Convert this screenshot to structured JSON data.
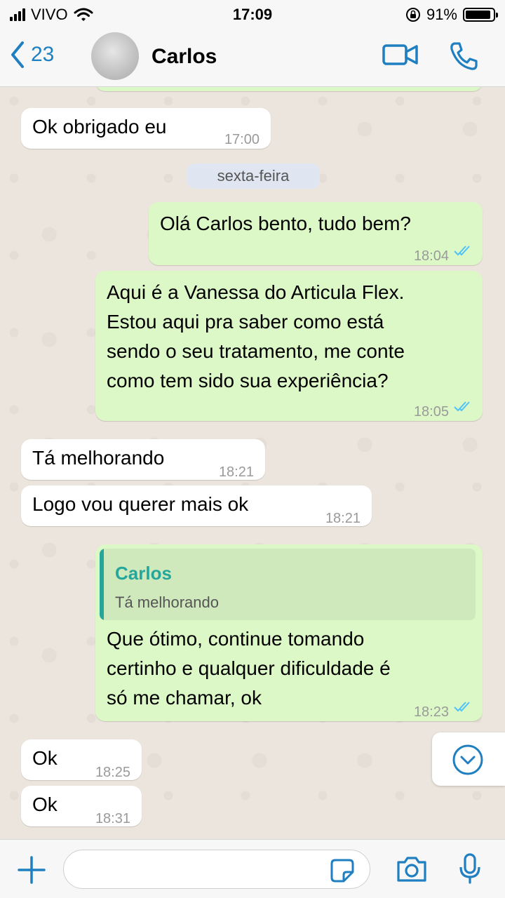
{
  "status": {
    "carrier": "VIVO",
    "time": "17:09",
    "battery": "91%",
    "battery_level": 0.91
  },
  "header": {
    "back_count": "23",
    "contact_name": "Carlos"
  },
  "colors": {
    "accent": "#1f7fc0",
    "outgoing": "#dcf8c6",
    "incoming": "#ffffff",
    "quote_name": "#26a69a",
    "read_ticks": "#4fc3f7"
  },
  "messages": [
    {
      "dir": "in",
      "text": "Ok obrigado eu",
      "time": "17:00"
    },
    {
      "dir": "out",
      "text": "Olá Carlos bento, tudo bem?",
      "time": "18:04",
      "read": true
    },
    {
      "dir": "out",
      "text": "Aqui é a Vanessa do Articula Flex.\nEstou aqui pra saber como está\nsendo o seu tratamento, me conte\ncomo tem sido sua experiência?",
      "time": "18:05",
      "read": true
    },
    {
      "dir": "in",
      "text": "Tá melhorando",
      "time": "18:21"
    },
    {
      "dir": "in",
      "text": "Logo vou querer mais ok",
      "time": "18:21"
    },
    {
      "dir": "out",
      "quote": {
        "name": "Carlos",
        "text": "Tá melhorando"
      },
      "text": "Que ótimo, continue tomando\ncertinho e qualquer dificuldade é\nsó me chamar, ok",
      "time": "18:23",
      "read": true
    },
    {
      "dir": "in",
      "text": "Ok",
      "time": "18:25"
    },
    {
      "dir": "in",
      "text": "Ok",
      "time": "18:31"
    }
  ],
  "date_separator": "sexta-feira",
  "input": {
    "placeholder": ""
  },
  "icons": {
    "back": "chevron-left-icon",
    "video": "video-camera-icon",
    "call": "phone-icon",
    "add": "plus-icon",
    "sticker": "sticker-icon",
    "camera": "camera-icon",
    "mic": "microphone-icon",
    "scroll": "chevron-down-circle-icon"
  }
}
